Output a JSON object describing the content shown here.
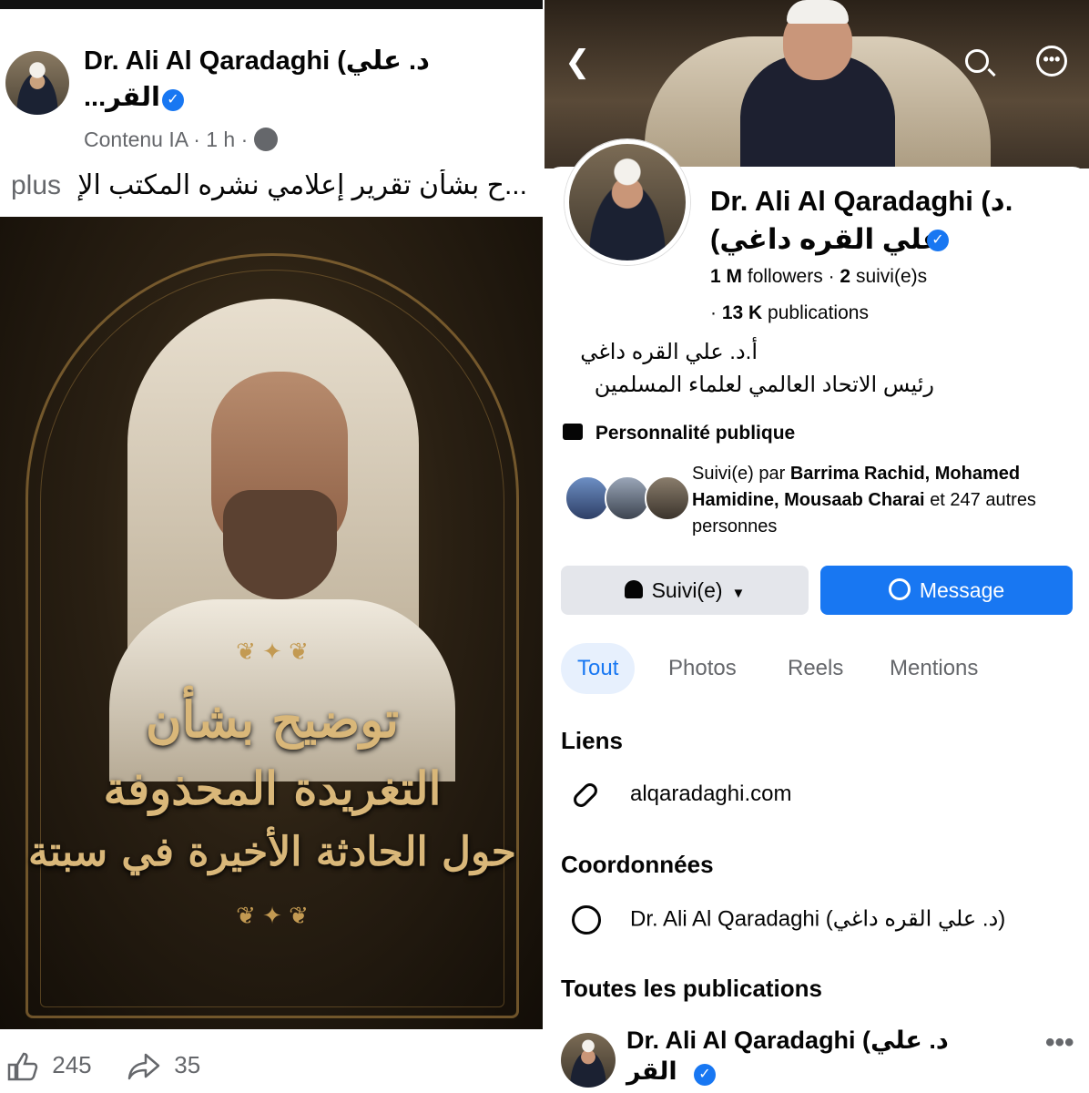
{
  "post": {
    "author_line1": "Dr. Ali Al Qaradaghi (د. علي",
    "author_line2": "القر...",
    "meta": "Contenu IA · 1 h ·",
    "text": "ح بشأن تقرير إعلامي نشره المكتب الإ...",
    "more": "plus",
    "image": {
      "headline1": "توضيح بشأن",
      "headline2": "التغريدة المحذوفة",
      "headline3": "حول الحادثة الأخيرة في سبتة"
    },
    "likes": "245",
    "shares": "35"
  },
  "profile": {
    "name_line1": "Dr. Ali Al Qaradaghi (د.",
    "name_line2": "علي القره داغي)",
    "followers_count": "1 M",
    "followers_label": "followers",
    "following_count": "2",
    "following_label": "suivi(e)s",
    "publications_count": "13 K",
    "publications_label": "publications",
    "bio_line1": "أ.د. علي القره داغي",
    "bio_line2": "رئيس  الاتحاد العالمي لعلماء المسلمين",
    "category": "Personnalité publique",
    "mutual_prefix": "Suivi(e) par",
    "mutual_names": "Barrima Rachid, Mohamed Hamidine, Mousaab Charai",
    "mutual_suffix": "et 247 autres personnes",
    "follow_button": "Suivi(e)",
    "message_button": "Message",
    "tabs": [
      {
        "label": "Tout",
        "active": true
      },
      {
        "label": "Photos",
        "active": false
      },
      {
        "label": "Reels",
        "active": false
      },
      {
        "label": "Mentions",
        "active": false
      }
    ],
    "links_title": "Liens",
    "website": "alqaradaghi.com",
    "contact_title": "Coordonnées",
    "messenger_name": "Dr. Ali Al Qaradaghi (د. علي القره داغي)",
    "posts_title": "Toutes les publications",
    "preview_author_line1": "Dr. Ali Al Qaradaghi (د. علي",
    "preview_author_line2": "القر"
  },
  "colors": {
    "facebook_blue": "#1877f2",
    "secondary_text": "#65676b",
    "button_grey": "#e4e6eb",
    "image_gold": "#d9b779"
  },
  "icons": [
    "globe-icon",
    "like-icon",
    "share-icon",
    "back-icon",
    "search-icon",
    "more-icon",
    "verified-icon",
    "category-icon",
    "bell-icon",
    "caret-down-icon",
    "messenger-icon",
    "link-icon"
  ]
}
